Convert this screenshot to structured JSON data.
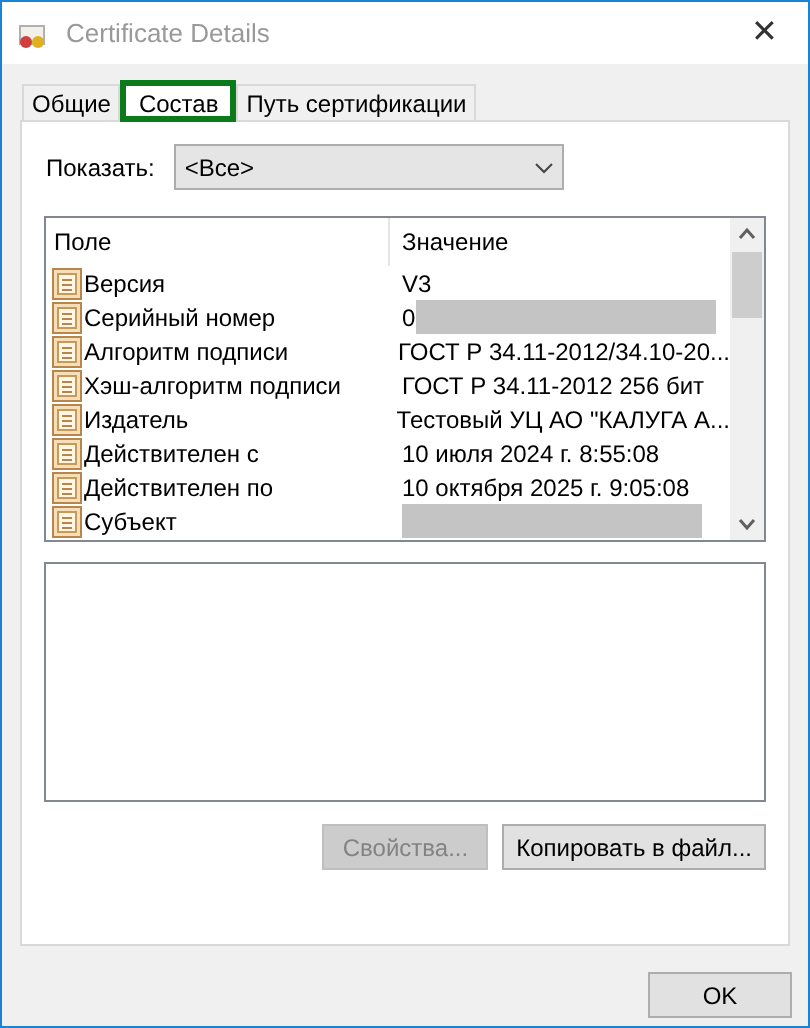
{
  "window": {
    "title": "Certificate Details",
    "close": "✕"
  },
  "tabs": [
    {
      "label": "Общие",
      "selected": false
    },
    {
      "label": "Состав",
      "selected": true
    },
    {
      "label": "Путь сертификации",
      "selected": false
    }
  ],
  "show": {
    "label": "Показать:",
    "value": "<Все>"
  },
  "table": {
    "columns": [
      "Поле",
      "Значение"
    ],
    "rows": [
      {
        "field": "Версия",
        "value": "V3",
        "redacted": false
      },
      {
        "field": "Серийный номер",
        "value": "0",
        "redacted": true
      },
      {
        "field": "Алгоритм подписи",
        "value": "ГОСТ Р 34.11-2012/34.10-20...",
        "redacted": false
      },
      {
        "field": "Хэш-алгоритм подписи",
        "value": "ГОСТ Р 34.11-2012 256 бит",
        "redacted": false
      },
      {
        "field": "Издатель",
        "value": "Тестовый УЦ АО \"КАЛУГА А...",
        "redacted": false
      },
      {
        "field": "Действителен с",
        "value": "10 июля 2024 г. 8:55:08",
        "redacted": false
      },
      {
        "field": "Действителен по",
        "value": "10 октября 2025 г. 9:05:08",
        "redacted": false
      },
      {
        "field": "Субъект",
        "value": "",
        "redacted": true
      }
    ]
  },
  "buttons": [
    {
      "label": "Свойства...",
      "disabled": true
    },
    {
      "label": "Копировать в файл...",
      "disabled": false
    }
  ],
  "ok": "OK"
}
